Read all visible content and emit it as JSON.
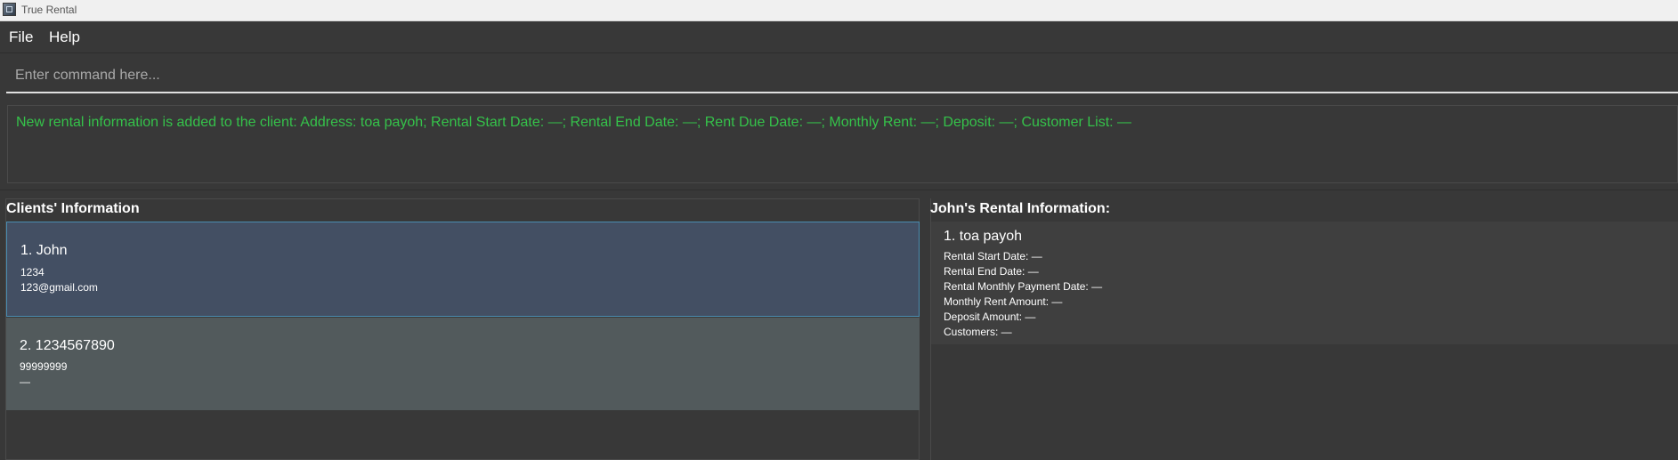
{
  "window": {
    "title": "True Rental",
    "icon": "app-icon"
  },
  "menu": {
    "items": [
      "File",
      "Help"
    ]
  },
  "command": {
    "placeholder": "Enter command here...",
    "value": ""
  },
  "result": {
    "message": "New rental information is added to the client: Address: toa payoh; Rental Start Date: —; Rental End Date: —; Rent Due Date: —; Monthly Rent: —; Deposit: —; Customer List: —",
    "color": "#35c24a"
  },
  "clients_panel": {
    "title": "Clients' Information",
    "clients": [
      {
        "name": "1. John",
        "phone": "1234",
        "email": "123@gmail.com",
        "selected": true
      },
      {
        "name": "2. 1234567890",
        "phone": "99999999",
        "email": "—",
        "selected": false
      }
    ]
  },
  "rental_panel": {
    "title": "John's Rental Information:",
    "rentals": [
      {
        "address": "1. toa payoh",
        "start": "Rental Start Date: —",
        "end": "Rental End Date: —",
        "payment": "Rental Monthly Payment Date: —",
        "monthly": "Monthly Rent Amount: —",
        "deposit": "Deposit Amount: —",
        "customers": "Customers: —"
      }
    ]
  },
  "colors": {
    "background": "#383838",
    "selected_card": "#434f63",
    "selected_border": "#4a8cb0",
    "card": "#525a5c"
  }
}
